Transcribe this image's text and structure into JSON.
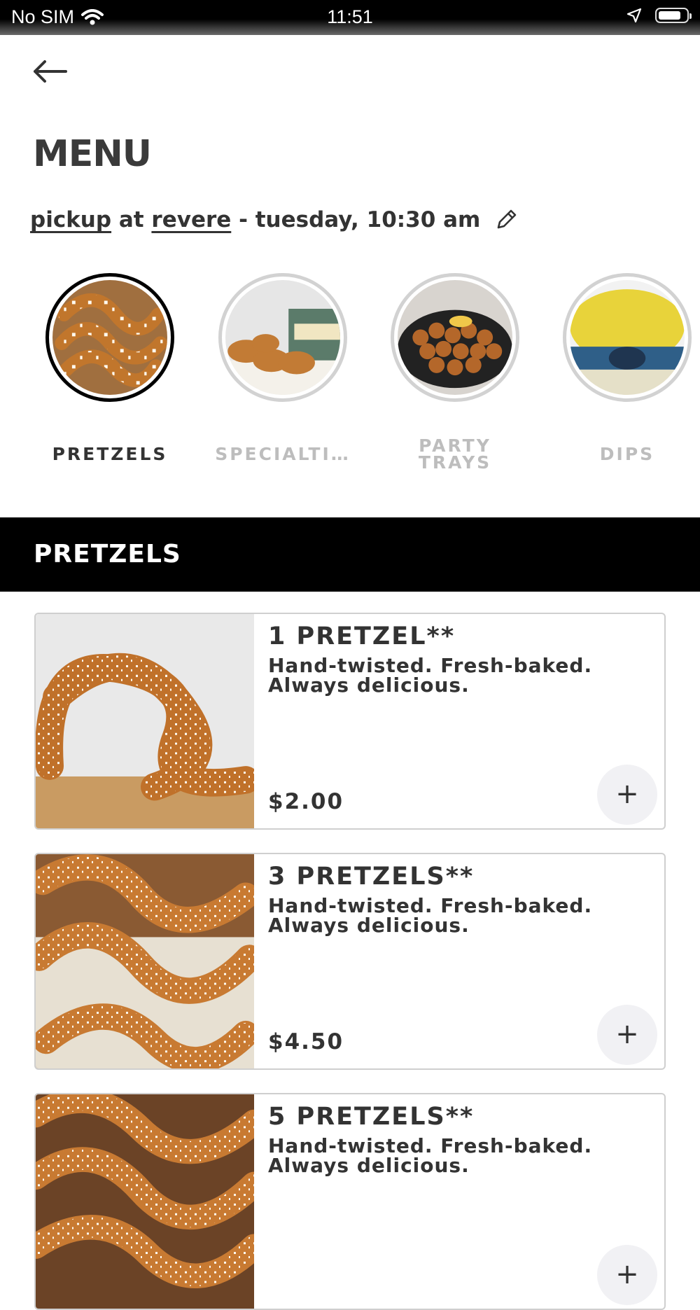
{
  "status_bar": {
    "carrier": "No SIM",
    "time": "11:51"
  },
  "header": {
    "title": "MENU"
  },
  "order_info": {
    "mode": "pickup",
    "connector": "at",
    "location": "revere",
    "schedule": "- tuesday, 10:30 am"
  },
  "categories": [
    {
      "label": "PRETZELS",
      "active": true
    },
    {
      "label": "SPECIALTI…",
      "active": false
    },
    {
      "label": "PARTY TRAYS",
      "active": false
    },
    {
      "label": "DIPS",
      "active": false
    }
  ],
  "section": {
    "title": "PRETZELS"
  },
  "items": [
    {
      "name": "1 PRETZEL**",
      "description": "Hand-twisted. Fresh-baked. Always delicious.",
      "price": "$2.00",
      "add_label": "+"
    },
    {
      "name": "3 PRETZELS**",
      "description": "Hand-twisted. Fresh-baked. Always delicious.",
      "price": "$4.50",
      "add_label": "+"
    },
    {
      "name": "5 PRETZELS**",
      "description": "Hand-twisted. Fresh-baked. Always delicious.",
      "price": "",
      "add_label": "+"
    }
  ],
  "icons": {
    "back": "arrow-left-icon",
    "edit": "pencil-icon",
    "add": "plus-icon",
    "wifi": "wifi-icon",
    "location": "location-arrow-icon",
    "battery": "battery-icon",
    "battery_level": 0.85
  },
  "colors": {
    "section_bar": "#000000",
    "active_ring": "#000000",
    "inactive_ring": "#d2d2d2",
    "text": "#333333"
  }
}
